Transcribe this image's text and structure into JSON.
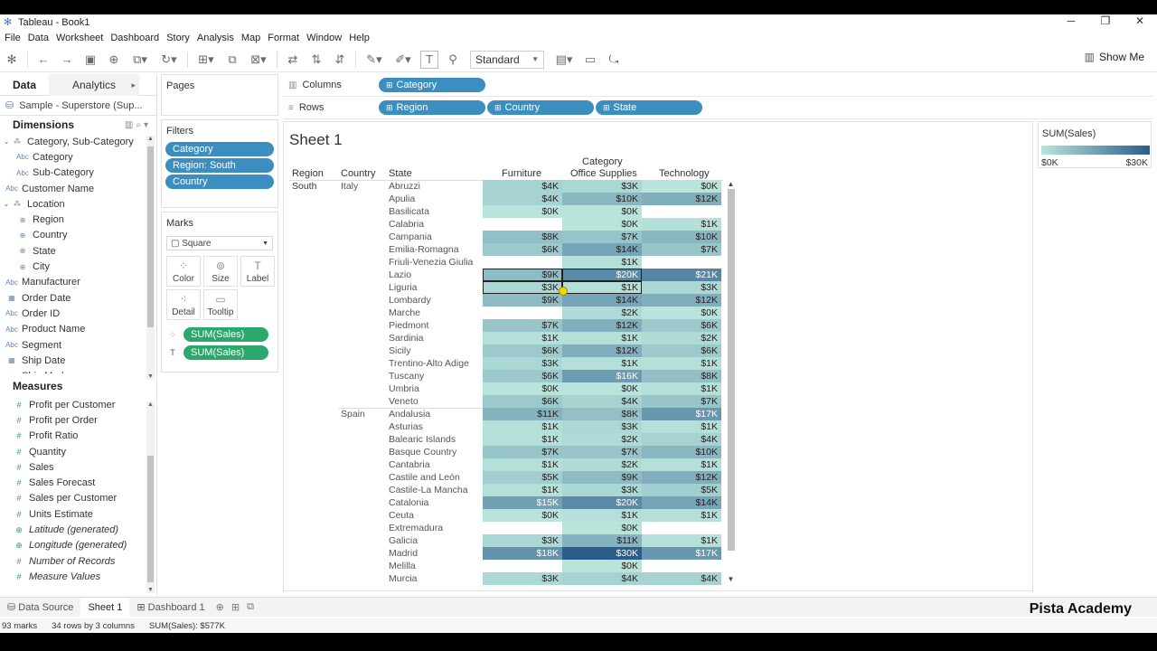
{
  "window": {
    "title": "Tableau - Book1"
  },
  "menu": [
    "File",
    "Data",
    "Worksheet",
    "Dashboard",
    "Story",
    "Analysis",
    "Map",
    "Format",
    "Window",
    "Help"
  ],
  "toolbar": {
    "fit": "Standard",
    "show_me": "Show Me"
  },
  "data_pane": {
    "tab_data": "Data",
    "tab_analytics": "Analytics",
    "source": "Sample - Superstore (Sup...",
    "dimensions_label": "Dimensions",
    "dimensions": [
      {
        "name": "Category, Sub-Category",
        "kind": "hier"
      },
      {
        "name": "Category",
        "kind": "abc",
        "indent": 1
      },
      {
        "name": "Sub-Category",
        "kind": "abc",
        "indent": 1
      },
      {
        "name": "Customer Name",
        "kind": "abc"
      },
      {
        "name": "Location",
        "kind": "hier"
      },
      {
        "name": "Region",
        "kind": "geo",
        "indent": 1
      },
      {
        "name": "Country",
        "kind": "geo",
        "indent": 1
      },
      {
        "name": "State",
        "kind": "geo",
        "indent": 1
      },
      {
        "name": "City",
        "kind": "geo",
        "indent": 1
      },
      {
        "name": "Manufacturer",
        "kind": "abc"
      },
      {
        "name": "Order Date",
        "kind": "date"
      },
      {
        "name": "Order ID",
        "kind": "abc"
      },
      {
        "name": "Product Name",
        "kind": "abc"
      },
      {
        "name": "Segment",
        "kind": "abc"
      },
      {
        "name": "Ship Date",
        "kind": "date"
      },
      {
        "name": "Ship Mode",
        "kind": "abc"
      }
    ],
    "measures_label": "Measures",
    "measures": [
      {
        "name": "Profit per Customer"
      },
      {
        "name": "Profit per Order"
      },
      {
        "name": "Profit Ratio"
      },
      {
        "name": "Quantity"
      },
      {
        "name": "Sales"
      },
      {
        "name": "Sales Forecast"
      },
      {
        "name": "Sales per Customer"
      },
      {
        "name": "Units Estimate"
      },
      {
        "name": "Latitude (generated)",
        "italic": true
      },
      {
        "name": "Longitude (generated)",
        "italic": true
      },
      {
        "name": "Number of Records",
        "italic": true
      },
      {
        "name": "Measure Values",
        "italic": true
      }
    ]
  },
  "pages_label": "Pages",
  "filters_label": "Filters",
  "filters": [
    "Category",
    "Region: South",
    "Country"
  ],
  "marks": {
    "label": "Marks",
    "type": "Square",
    "buttons": [
      "Color",
      "Size",
      "Label",
      "Detail",
      "Tooltip"
    ],
    "fields": [
      "SUM(Sales)",
      "SUM(Sales)"
    ]
  },
  "shelves": {
    "columns_label": "Columns",
    "columns": [
      "Category"
    ],
    "rows_label": "Rows",
    "rows": [
      "Region",
      "Country",
      "State"
    ]
  },
  "sheet": {
    "title": "Sheet 1",
    "col_group": "Category",
    "row_headers": [
      "Region",
      "Country",
      "State"
    ],
    "col_headers": [
      "Furniture",
      "Office Supplies",
      "Technology"
    ],
    "region": "South",
    "countries": [
      {
        "name": "Italy",
        "states": [
          [
            "Abruzzi",
            "$4K",
            "$3K",
            "$0K"
          ],
          [
            "Apulia",
            "$4K",
            "$10K",
            "$12K"
          ],
          [
            "Basilicata",
            "$0K",
            "$0K",
            ""
          ],
          [
            "Calabria",
            "",
            "$0K",
            "$1K"
          ],
          [
            "Campania",
            "$8K",
            "$7K",
            "$10K"
          ],
          [
            "Emilia-Romagna",
            "$6K",
            "$14K",
            "$7K"
          ],
          [
            "Friuli-Venezia Giulia",
            "",
            "$1K",
            ""
          ],
          [
            "Lazio",
            "$9K",
            "$20K",
            "$21K"
          ],
          [
            "Liguria",
            "$3K",
            "$1K",
            "$3K"
          ],
          [
            "Lombardy",
            "$9K",
            "$14K",
            "$12K"
          ],
          [
            "Marche",
            "",
            "$2K",
            "$0K"
          ],
          [
            "Piedmont",
            "$7K",
            "$12K",
            "$6K"
          ],
          [
            "Sardinia",
            "$1K",
            "$1K",
            "$2K"
          ],
          [
            "Sicily",
            "$6K",
            "$12K",
            "$6K"
          ],
          [
            "Trentino-Alto Adige",
            "$3K",
            "$1K",
            "$1K"
          ],
          [
            "Tuscany",
            "$6K",
            "$16K",
            "$8K"
          ],
          [
            "Umbria",
            "$0K",
            "$0K",
            "$1K"
          ],
          [
            "Veneto",
            "$6K",
            "$4K",
            "$7K"
          ]
        ]
      },
      {
        "name": "Spain",
        "states": [
          [
            "Andalusia",
            "$11K",
            "$8K",
            "$17K"
          ],
          [
            "Asturias",
            "$1K",
            "$3K",
            "$1K"
          ],
          [
            "Balearic Islands",
            "$1K",
            "$2K",
            "$4K"
          ],
          [
            "Basque Country",
            "$7K",
            "$7K",
            "$10K"
          ],
          [
            "Cantabria",
            "$1K",
            "$2K",
            "$1K"
          ],
          [
            "Castile and León",
            "$5K",
            "$9K",
            "$12K"
          ],
          [
            "Castile-La Mancha",
            "$1K",
            "$3K",
            "$5K"
          ],
          [
            "Catalonia",
            "$15K",
            "$20K",
            "$14K"
          ],
          [
            "Ceuta",
            "$0K",
            "$1K",
            "$1K"
          ],
          [
            "Extremadura",
            "",
            "$0K",
            ""
          ],
          [
            "Galicia",
            "$3K",
            "$11K",
            "$1K"
          ],
          [
            "Madrid",
            "$18K",
            "$30K",
            "$17K"
          ],
          [
            "Melilla",
            "",
            "$0K",
            ""
          ],
          [
            "Murcia",
            "$3K",
            "$4K",
            "$4K"
          ]
        ]
      }
    ]
  },
  "legend": {
    "title": "SUM(Sales)",
    "min": "$0K",
    "max": "$30K",
    "color_low": "#b9e4dc",
    "color_high": "#2a5d8c"
  },
  "tabs": {
    "data_source": "Data Source",
    "sheet1": "Sheet 1",
    "dashboard1": "Dashboard 1"
  },
  "status": {
    "marks": "93 marks",
    "rows": "34 rows by 3 columns",
    "sum": "SUM(Sales): $577K"
  },
  "brand": "Pista Academy"
}
